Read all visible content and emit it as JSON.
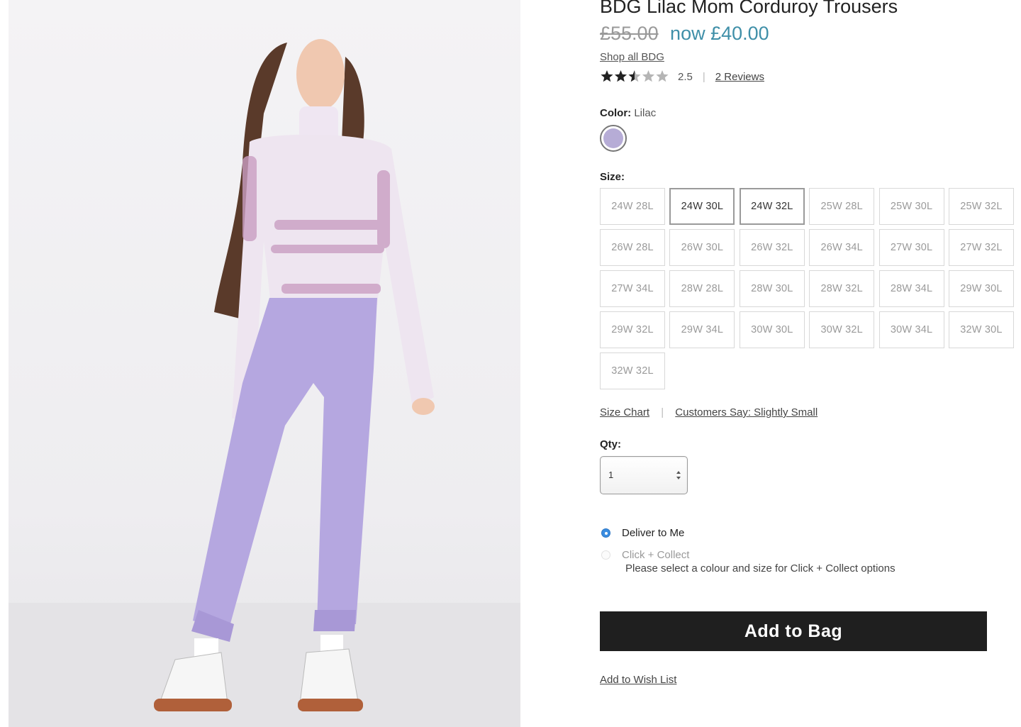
{
  "product": {
    "title": "BDG Lilac Mom Corduroy Trousers",
    "price_old": "£55.00",
    "price_now": "now £40.00",
    "shop_all": "Shop all BDG",
    "rating": 2.5,
    "rating_text": "2.5",
    "reviews_link": "2 Reviews",
    "image_icon": "model-photo"
  },
  "color": {
    "label": "Color:",
    "value": "Lilac",
    "swatch_hex": "#b6acd6"
  },
  "size": {
    "label": "Size:",
    "options": [
      {
        "label": "24W 28L",
        "available": false
      },
      {
        "label": "24W 30L",
        "available": true
      },
      {
        "label": "24W 32L",
        "available": true
      },
      {
        "label": "25W 28L",
        "available": false
      },
      {
        "label": "25W 30L",
        "available": false
      },
      {
        "label": "25W 32L",
        "available": false
      },
      {
        "label": "26W 28L",
        "available": false
      },
      {
        "label": "26W 30L",
        "available": false
      },
      {
        "label": "26W 32L",
        "available": false
      },
      {
        "label": "26W 34L",
        "available": false
      },
      {
        "label": "27W 30L",
        "available": false
      },
      {
        "label": "27W 32L",
        "available": false
      },
      {
        "label": "27W 34L",
        "available": false
      },
      {
        "label": "28W 28L",
        "available": false
      },
      {
        "label": "28W 30L",
        "available": false
      },
      {
        "label": "28W 32L",
        "available": false
      },
      {
        "label": "28W 34L",
        "available": false
      },
      {
        "label": "29W 30L",
        "available": false
      },
      {
        "label": "29W 32L",
        "available": false
      },
      {
        "label": "29W 34L",
        "available": false
      },
      {
        "label": "30W 30L",
        "available": false
      },
      {
        "label": "30W 32L",
        "available": false
      },
      {
        "label": "30W 34L",
        "available": false
      },
      {
        "label": "32W 30L",
        "available": false
      },
      {
        "label": "32W 32L",
        "available": false
      }
    ],
    "size_chart_link": "Size Chart",
    "fit_link": "Customers Say: Slightly Small"
  },
  "qty": {
    "label": "Qty:",
    "value": "1"
  },
  "delivery": {
    "deliver_label": "Deliver to Me",
    "deliver_selected": true,
    "collect_label": "Click + Collect",
    "collect_note": "Please select a colour and size for Click + Collect options"
  },
  "actions": {
    "add_to_bag": "Add to Bag",
    "wishlist": "Add to Wish List"
  },
  "colors": {
    "price_now": "#3f8fa8",
    "button_bg": "#1f1f1f",
    "radio_selected": "#3b8de0"
  }
}
